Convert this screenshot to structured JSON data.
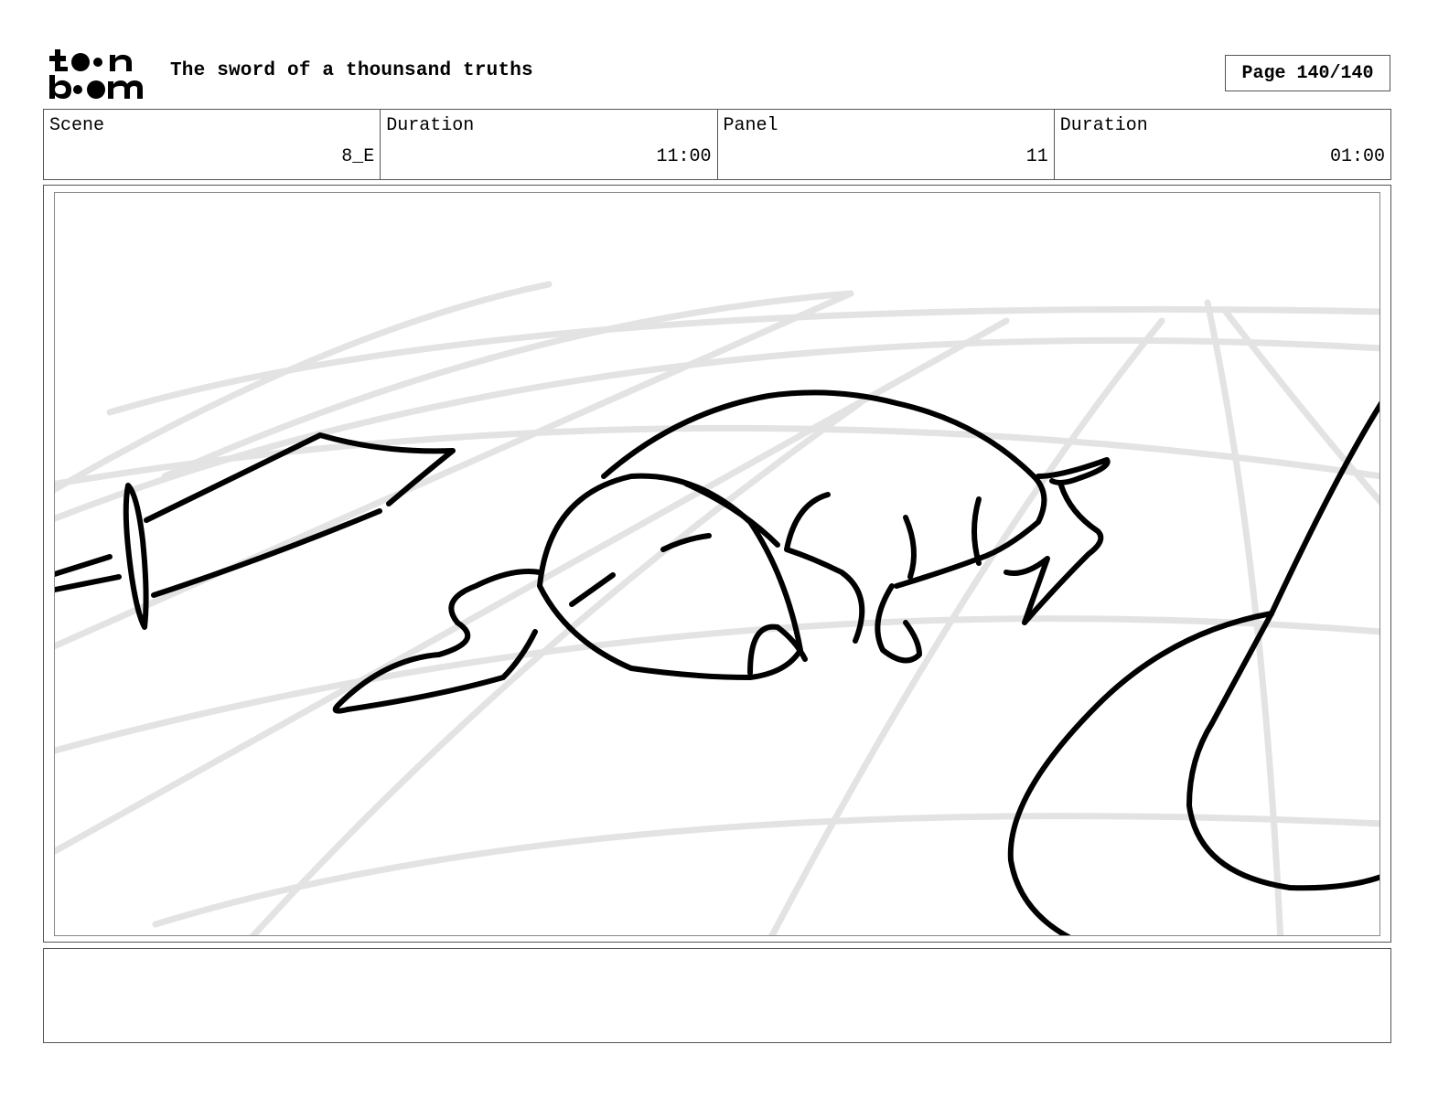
{
  "header": {
    "brand_logo": "toonboom-logo",
    "title": "The sword of a thounsand truths",
    "page_label": "Page 140/140"
  },
  "info": {
    "scene_label": "Scene",
    "scene_value": "8_E",
    "scene_duration_label": "Duration",
    "scene_duration_value": "11:00",
    "panel_label": "Panel",
    "panel_value": "11",
    "panel_duration_label": "Duration",
    "panel_duration_value": "01:00"
  },
  "panel": {
    "sketch_stroke_color": "#000000",
    "guide_stroke_color": "#e3e3e3"
  },
  "notes": {
    "text": ""
  }
}
